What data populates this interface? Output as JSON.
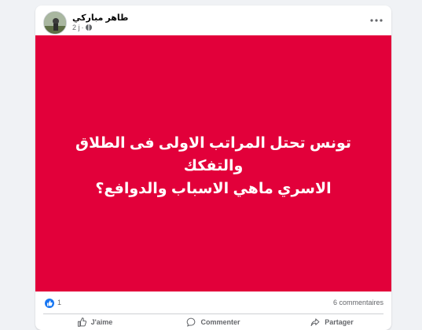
{
  "post": {
    "author": "طاهر مباركي",
    "time": "2 j",
    "image_text_line1": "تونس تحتل المراتب الاولى فى الطلاق والتفكك",
    "image_text_line2": "الاسري ماهي الاسباب والدوافع؟",
    "image_bg_color": "#e2003a"
  },
  "stats": {
    "likes": "1",
    "comments": "6 commentaires"
  },
  "actions": {
    "like": "J'aime",
    "comment": "Commenter",
    "share": "Partager"
  },
  "icons": {
    "like": "thumbs-up-icon",
    "comment": "comment-icon",
    "share": "share-icon",
    "privacy": "globe-icon",
    "menu": "more-horizontal-icon"
  }
}
